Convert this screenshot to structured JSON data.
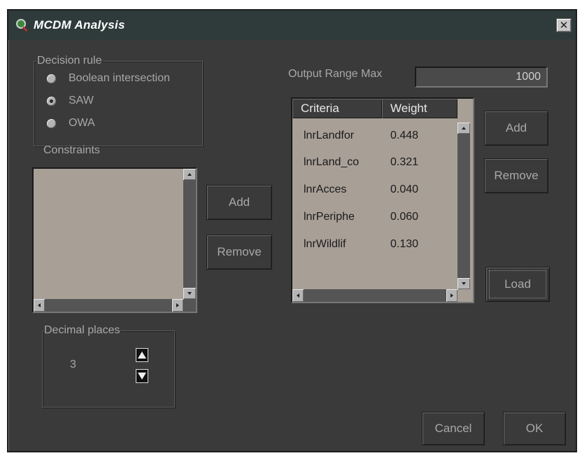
{
  "window": {
    "title": "MCDM Analysis",
    "close_glyph": "✕",
    "icon": "magnifier-icon"
  },
  "decision_rule": {
    "legend": "Decision rule",
    "options": [
      {
        "label": "Boolean intersection",
        "selected": false
      },
      {
        "label": "SAW",
        "selected": true
      },
      {
        "label": "OWA",
        "selected": false
      }
    ]
  },
  "output_range": {
    "label": "Output Range Max",
    "value": "1000"
  },
  "constraints": {
    "label": "Constraints",
    "add_label": "Add",
    "remove_label": "Remove"
  },
  "criteria": {
    "columns": [
      "Criteria",
      "Weight"
    ],
    "rows": [
      {
        "name": "lnrLandfor",
        "weight": "0.448"
      },
      {
        "name": "lnrLand_co",
        "weight": "0.321"
      },
      {
        "name": "lnrAcces",
        "weight": "0.040"
      },
      {
        "name": "lnrPeriphe",
        "weight": "0.060"
      },
      {
        "name": "lnrWildlif",
        "weight": "0.130"
      }
    ],
    "add_label": "Add",
    "remove_label": "Remove",
    "load_label": "Load"
  },
  "decimal_places": {
    "legend": "Decimal places",
    "value": "3"
  },
  "footer": {
    "cancel_label": "Cancel",
    "ok_label": "OK"
  },
  "colors": {
    "background": "#3a3a3a",
    "list_bg": "#a89f97",
    "title_bar": "#2f3b3a"
  }
}
